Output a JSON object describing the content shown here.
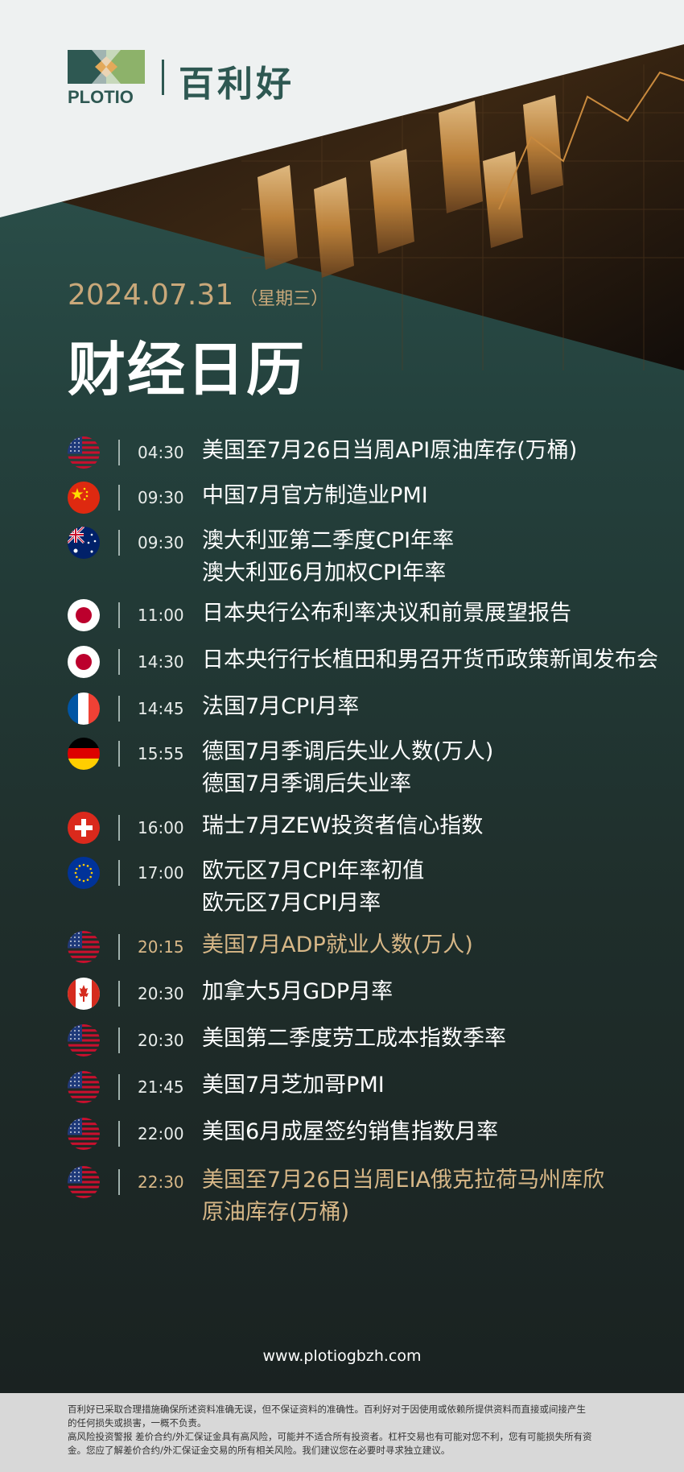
{
  "brand": {
    "logo_text": "PLOTIO",
    "name": "百利好"
  },
  "header": {
    "date": "2024.07.31",
    "weekday": "（星期三）",
    "title": "财经日历"
  },
  "colors": {
    "primary": "#2e5852",
    "gold": "#c9a87a",
    "highlight": "#d7b787",
    "white": "#ffffff"
  },
  "events": [
    {
      "flag": "us-flag",
      "time": "04:30",
      "lines": [
        "美国至7月26日当周API原油库存(万桶)"
      ],
      "highlight": false
    },
    {
      "flag": "china-flag",
      "time": "09:30",
      "lines": [
        "中国7月官方制造业PMI"
      ],
      "highlight": false
    },
    {
      "flag": "australia-flag",
      "time": "09:30",
      "lines": [
        "澳大利亚第二季度CPI年率",
        "澳大利亚6月加权CPI年率"
      ],
      "highlight": false
    },
    {
      "flag": "japan-flag",
      "time": "11:00",
      "lines": [
        "日本央行公布利率决议和前景展望报告"
      ],
      "highlight": false
    },
    {
      "flag": "japan-flag",
      "time": "14:30",
      "lines": [
        "日本央行行长植田和男召开货币政策新闻发布会"
      ],
      "highlight": false
    },
    {
      "flag": "france-flag",
      "time": "14:45",
      "lines": [
        "法国7月CPI月率"
      ],
      "highlight": false
    },
    {
      "flag": "germany-flag",
      "time": "15:55",
      "lines": [
        "德国7月季调后失业人数(万人)",
        "德国7月季调后失业率"
      ],
      "highlight": false
    },
    {
      "flag": "switzerland-flag",
      "time": "16:00",
      "lines": [
        "瑞士7月ZEW投资者信心指数"
      ],
      "highlight": false
    },
    {
      "flag": "eu-flag",
      "time": "17:00",
      "lines": [
        "欧元区7月CPI年率初值",
        "欧元区7月CPI月率"
      ],
      "highlight": false
    },
    {
      "flag": "us-flag",
      "time": "20:15",
      "lines": [
        "美国7月ADP就业人数(万人)"
      ],
      "highlight": true
    },
    {
      "flag": "canada-flag",
      "time": "20:30",
      "lines": [
        "加拿大5月GDP月率"
      ],
      "highlight": false
    },
    {
      "flag": "us-flag",
      "time": "20:30",
      "lines": [
        "美国第二季度劳工成本指数季率"
      ],
      "highlight": false
    },
    {
      "flag": "us-flag",
      "time": "21:45",
      "lines": [
        "美国7月芝加哥PMI"
      ],
      "highlight": false
    },
    {
      "flag": "us-flag",
      "time": "22:00",
      "lines": [
        "美国6月成屋签约销售指数月率"
      ],
      "highlight": false
    },
    {
      "flag": "us-flag",
      "time": "22:30",
      "lines": [
        "美国至7月26日当周EIA俄克拉荷马州库欣",
        "原油库存(万桶)"
      ],
      "highlight": true
    }
  ],
  "website": "www.plotiogbzh.com",
  "disclaimer": {
    "line1": "百利好已采取合理措施确保所述资料准确无误，但不保证资料的准确性。百利好对于因使用或依赖所提供资料而直接或间接产生",
    "line2": "的任何损失或损害，一概不负责。",
    "line3": "高风险投资警报 差价合约/外汇保证金具有高风险，可能并不适合所有投资者。杠杆交易也有可能对您不利，您有可能损失所有资",
    "line4": "金。您应了解差价合约/外汇保证金交易的所有相关风险。我们建议您在必要时寻求独立建议。"
  }
}
